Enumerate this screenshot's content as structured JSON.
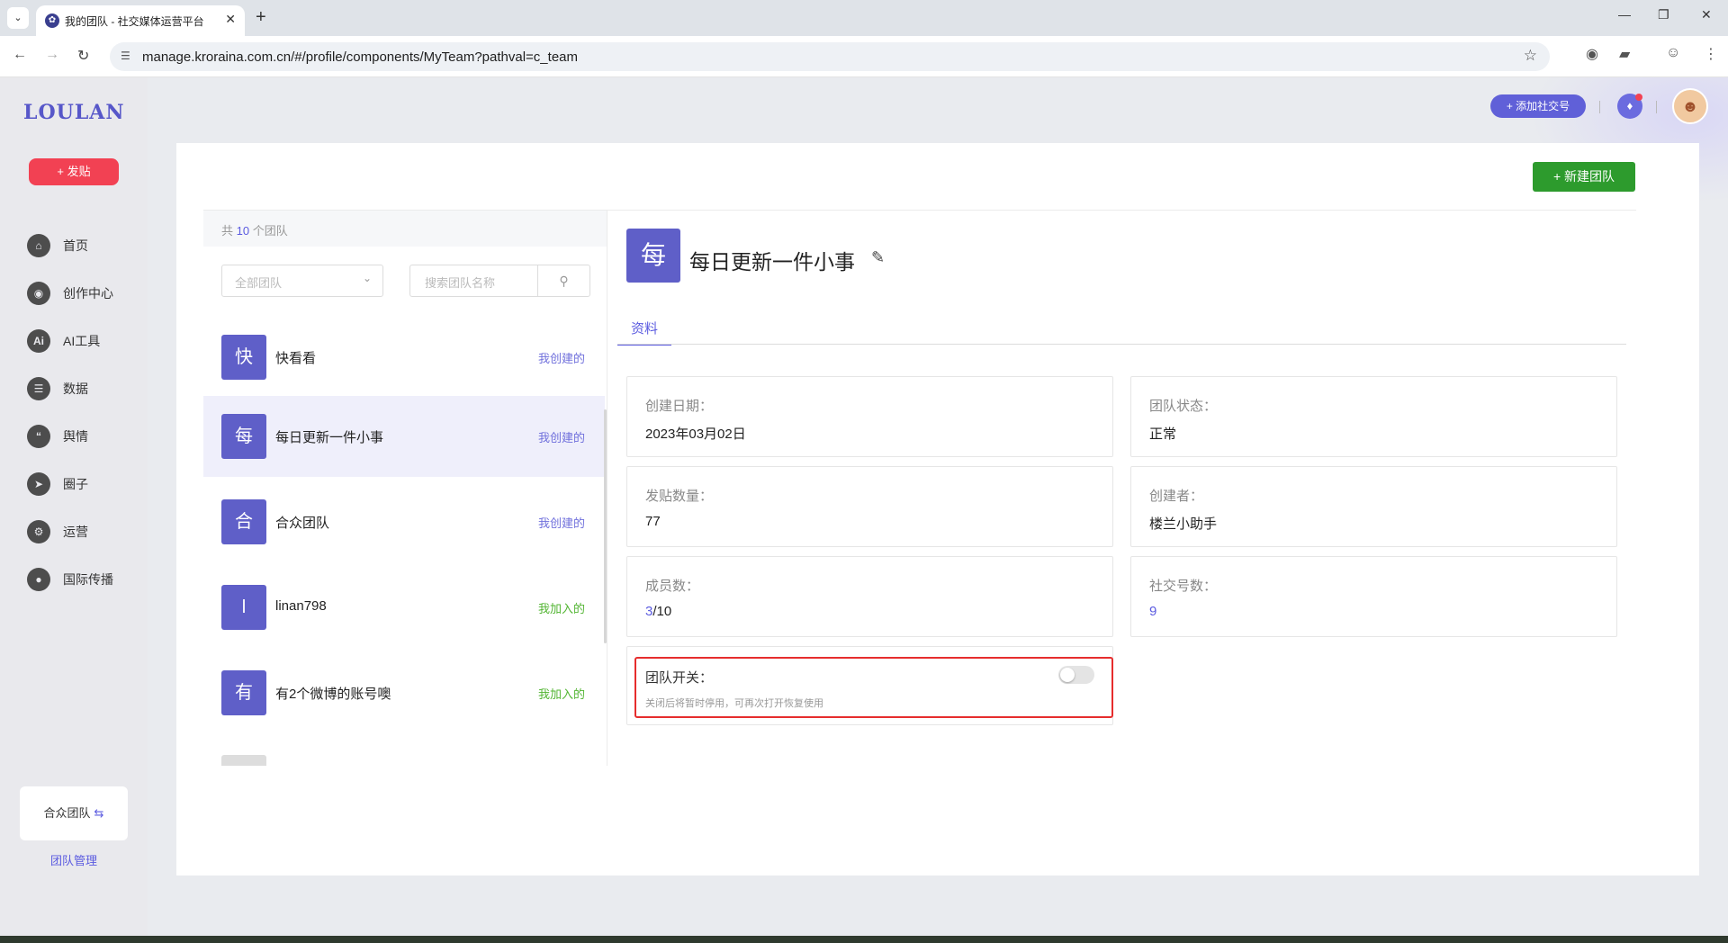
{
  "browser": {
    "tab_title": "我的团队 - 社交媒体运营平台",
    "new_tab": "+",
    "url": "manage.kroraina.com.cn/#/profile/components/MyTeam?pathval=c_team"
  },
  "sidebar": {
    "logo": "LOULAN",
    "post_button": "+ 发贴",
    "menu": [
      {
        "label": "首页",
        "icon": "home-icon"
      },
      {
        "label": "创作中心",
        "icon": "palette-icon"
      },
      {
        "label": "AI工具",
        "icon": "ai-icon"
      },
      {
        "label": "数据",
        "icon": "database-icon"
      },
      {
        "label": "舆情",
        "icon": "quote-icon"
      },
      {
        "label": "圈子",
        "icon": "compass-icon"
      },
      {
        "label": "运营",
        "icon": "operation-icon"
      },
      {
        "label": "国际传播",
        "icon": "globe-icon"
      }
    ],
    "current_team": "合众团队",
    "team_manage": "团队管理"
  },
  "header": {
    "add_social": "+ 添加社交号"
  },
  "main": {
    "new_team_button": "+ 新建团队",
    "count_prefix": "共",
    "count_value": "10",
    "count_suffix": "个团队",
    "filter_value": "全部团队",
    "search_placeholder": "搜索团队名称",
    "teams": [
      {
        "initial": "快",
        "name": "快看看",
        "tag": "我创建的"
      },
      {
        "initial": "每",
        "name": "每日更新一件小事",
        "tag": "我创建的"
      },
      {
        "initial": "合",
        "name": "合众团队",
        "tag": "我创建的"
      },
      {
        "initial": "l",
        "name": "linan798",
        "tag": "我加入的"
      },
      {
        "initial": "有",
        "name": "有2个微博的账号噢",
        "tag": "我加入的"
      }
    ]
  },
  "detail": {
    "initial": "每",
    "title": "每日更新一件小事",
    "tab": "资料",
    "fields": {
      "created_label": "创建日期：",
      "created_value": "2023年03月02日",
      "status_label": "团队状态：",
      "status_value": "正常",
      "posts_label": "发贴数量：",
      "posts_value": "77",
      "creator_label": "创建者：",
      "creator_value": "楼兰小助手",
      "members_label": "成员数：",
      "members_current": "3",
      "members_total": "/10",
      "social_label": "社交号数：",
      "social_value": "9"
    },
    "toggle": {
      "label": "团队开关：",
      "hint": "关闭后将暂时停用，可再次打开恢复使用",
      "on": false
    }
  },
  "colors": {
    "accent": "#5b5be0",
    "post_button": "#f24153",
    "new_team_button": "#2d9b2d",
    "highlight_border": "#e62d2d"
  }
}
